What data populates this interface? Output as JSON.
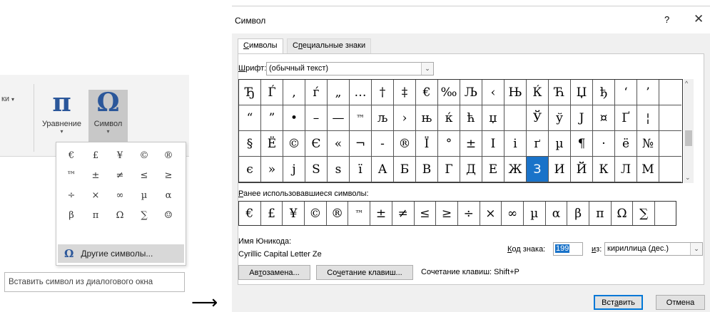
{
  "ribbon": {
    "cut_label": "ки",
    "equation": {
      "icon": "π",
      "label": "Уравнение"
    },
    "symbol": {
      "icon": "Ω",
      "label": "Символ"
    }
  },
  "symbol_popup": {
    "symbols": [
      "€",
      "£",
      "¥",
      "©",
      "®",
      "™",
      "±",
      "≠",
      "≤",
      "≥",
      "÷",
      "×",
      "∞",
      "µ",
      "α",
      "β",
      "π",
      "Ω",
      "∑",
      "☺"
    ],
    "more_icon": "Ω",
    "more_label": "Другие символы..."
  },
  "tooltip": "Вставить символ из диалогового окна",
  "arrow": "⟶",
  "dialog": {
    "title": "Символ",
    "help": "?",
    "close": "✕",
    "tabs": [
      "Символы",
      "Специальные знаки"
    ],
    "font_label": "Шрифт:",
    "font_value": "(обычный текст)",
    "symbol_grid": [
      "Ђ",
      "Ѓ",
      "‚",
      "ѓ",
      "„",
      "…",
      "†",
      "‡",
      "€",
      "‰",
      "Љ",
      "‹",
      "Њ",
      "Ќ",
      "Ћ",
      "Џ",
      "ђ",
      "‘",
      "’",
      "",
      "“",
      "”",
      "•",
      "–",
      "—",
      "™",
      "љ",
      "›",
      "њ",
      "ќ",
      "ћ",
      "џ",
      " ",
      "Ў",
      "ў",
      "Ј",
      "¤",
      "Ґ",
      "¦",
      "",
      "§",
      "Ё",
      "©",
      "Є",
      "«",
      "¬",
      "-",
      "®",
      "Ї",
      "°",
      "±",
      "І",
      "і",
      "ґ",
      "µ",
      "¶",
      "·",
      "ё",
      "№",
      "",
      "є",
      "»",
      "ј",
      "Ѕ",
      "ѕ",
      "ї",
      "А",
      "Б",
      "В",
      "Г",
      "Д",
      "Е",
      "Ж",
      "З",
      "И",
      "Й",
      "К",
      "Л",
      "М",
      ""
    ],
    "selected_symbol": "З",
    "recent_label": "Ранее использовавшиеся символы:",
    "recent_symbols": [
      "€",
      "£",
      "¥",
      "©",
      "®",
      "™",
      "±",
      "≠",
      "≤",
      "≥",
      "÷",
      "×",
      "∞",
      "µ",
      "α",
      "β",
      "π",
      "Ω",
      "∑",
      ""
    ],
    "unicode_label": "Имя Юникода:",
    "unicode_name": "Cyrillic Capital Letter Ze",
    "code_label": "Код знака:",
    "code_value": "199",
    "from_label": "из:",
    "from_value": "кириллица (дес.)",
    "autocorrect_btn": "Автозамена...",
    "shortcut_btn": "Сочетание клавиш...",
    "shortcut_text": "Сочетание клавиш: Shift+P",
    "insert_btn": "Вставить",
    "cancel_btn": "Отмена"
  }
}
